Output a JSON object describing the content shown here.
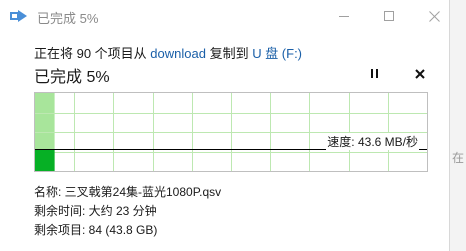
{
  "window": {
    "title": "已完成 5%",
    "status": "已完成 5%",
    "progress_percent": 5
  },
  "info": {
    "prefix": "正在将 90 个项目从 ",
    "source": "download",
    "middle": " 复制到 ",
    "destination": "U 盘 (F:)"
  },
  "graph": {
    "speed_label": "速度: 43.6 MB/秒",
    "accent_color": "#06b025",
    "fill_color": "#a8e59b",
    "grid_color": "#bde8b1"
  },
  "details": {
    "name": "名称: 三叉戟第24集-蓝光1080P.qsv",
    "time_left": "剩余时间: 大约 23 分钟",
    "items_left": "剩余项目: 84 (43.8 GB)"
  },
  "background": {
    "edge_text": "在"
  },
  "icons": {
    "app": "copy-arrow-icon",
    "minimize": "minimize-icon",
    "maximize": "maximize-icon",
    "close": "close-icon",
    "pause": "pause-icon",
    "stop": "stop-icon"
  }
}
